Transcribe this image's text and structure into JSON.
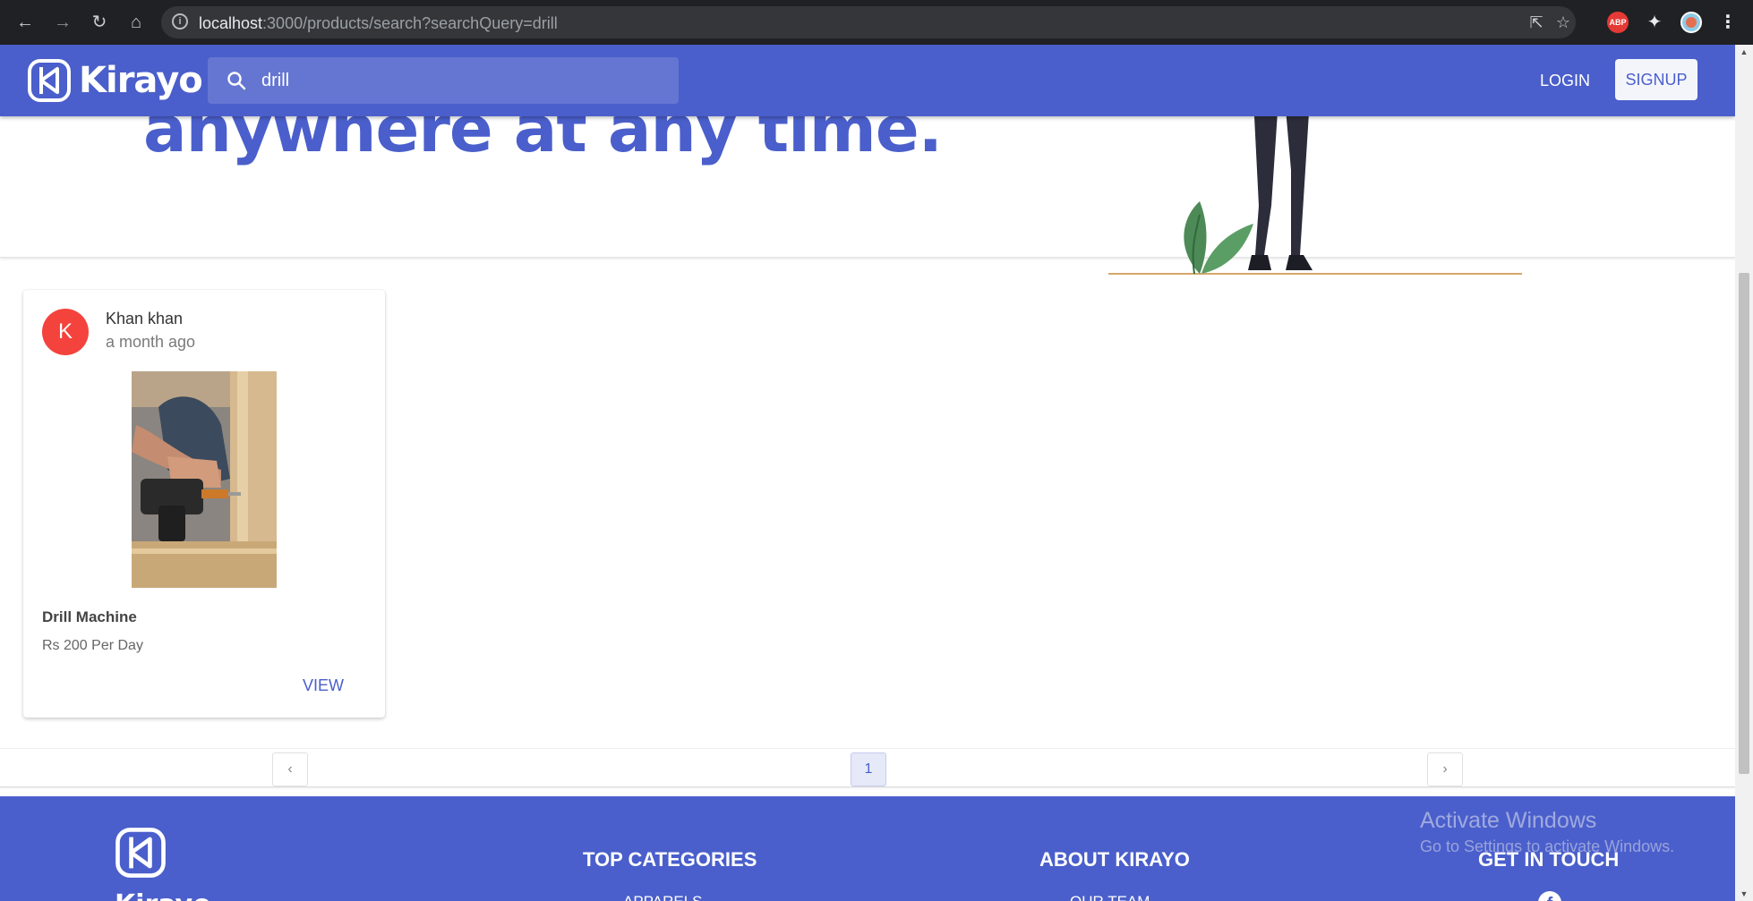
{
  "browser": {
    "url_host": "localhost",
    "url_rest": ":3000/products/search?searchQuery=drill"
  },
  "hero": {
    "text": "anywhere at any time."
  },
  "appbar": {
    "brand": "Kirayo",
    "search_value": "drill",
    "login_label": "LOGIN",
    "signup_label": "SIGNUP"
  },
  "products": [
    {
      "avatar_letter": "K",
      "user": "Khan khan",
      "time": "a month ago",
      "title": "Drill Machine",
      "price": "Rs 200 Per Day",
      "view_label": "VIEW"
    }
  ],
  "pagination": {
    "prev": "‹",
    "current": "1",
    "next": "›"
  },
  "footer": {
    "brand": "Kirayo",
    "col1_title": "TOP CATEGORIES",
    "col1_link": "APPARELS",
    "col2_title": "ABOUT KIRAYO",
    "col2_link": "OUR TEAM",
    "col3_title": "GET IN TOUCH"
  },
  "watermark": {
    "title": "Activate Windows",
    "subtitle": "Go to Settings to activate Windows."
  },
  "colors": {
    "brand": "#4a5fcb",
    "avatar": "#f4433c"
  }
}
